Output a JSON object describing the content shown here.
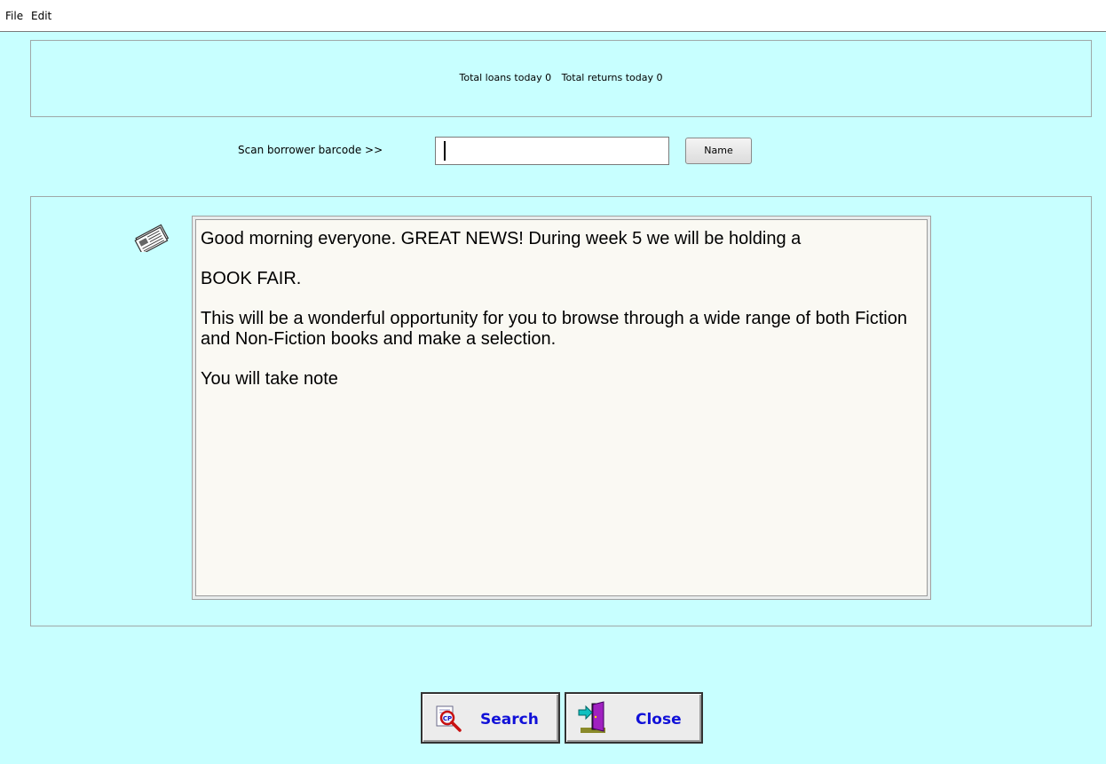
{
  "menu": {
    "file": "File",
    "edit": "Edit"
  },
  "stats": {
    "loans": "Total loans today 0",
    "returns": "Total returns today 0"
  },
  "scan": {
    "label": "Scan borrower barcode >>",
    "value": "",
    "name_button": "Name"
  },
  "message": {
    "icon": "newspaper-icon",
    "paragraphs": [
      "Good morning everyone. GREAT NEWS! During week 5 we will be holding a",
      "BOOK FAIR.",
      "This will be a wonderful opportunity for you to  browse through a wide range of both Fiction and Non-Fiction books and make a selection.",
      "You will take note"
    ]
  },
  "buttons": {
    "search": "Search",
    "close": "Close"
  },
  "colors": {
    "background": "#c8ffff",
    "message_bg": "#faf9f3",
    "button_text": "#1010d8"
  }
}
